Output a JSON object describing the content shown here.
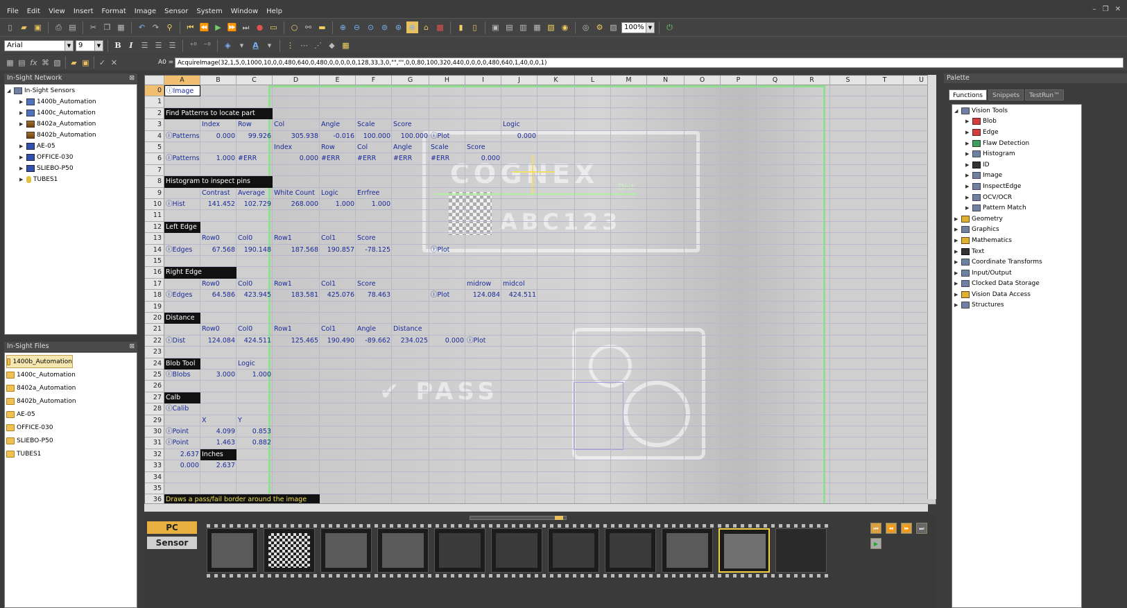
{
  "menu": [
    "File",
    "Edit",
    "View",
    "Insert",
    "Format",
    "Image",
    "Sensor",
    "System",
    "Window",
    "Help"
  ],
  "window_controls": "– ❐ ✕",
  "toolbar": {
    "zoom": "100%",
    "font_name": "Arial",
    "font_size": "9"
  },
  "formula": {
    "cell_ref": "A0 =",
    "text": "AcquireImage(32,1,5,0,1000,10,0,0,480,640,0,480,0,0,0,0,0,128,33,3,0,\"\",\"\",0,0,80,100,320,440,0,0,0,0,480,640,1,40,0,0,1)"
  },
  "network": {
    "title": "In-Sight Network",
    "root": "In-Sight Sensors",
    "items": [
      "1400b_Automation",
      "1400c_Automation",
      "8402a_Automation",
      "8402b_Automation",
      "AE-05",
      "OFFICE-030",
      "SLIEBO-P50",
      "TUBES1"
    ]
  },
  "files": {
    "title": "In-Sight Files",
    "items": [
      "1400b_Automation",
      "1400c_Automation",
      "8402a_Automation",
      "8402b_Automation",
      "AE-05",
      "OFFICE-030",
      "SLIEBO-P50",
      "TUBES1"
    ]
  },
  "sheet": {
    "columns": [
      "A",
      "B",
      "C",
      "D",
      "E",
      "F",
      "G",
      "H",
      "I",
      "J",
      "K",
      "L",
      "M",
      "N",
      "O",
      "P",
      "Q",
      "R",
      "S",
      "T",
      "U"
    ],
    "rows": [
      "0",
      "1",
      "2",
      "3",
      "4",
      "5",
      "6",
      "7",
      "8",
      "9",
      "10",
      "11",
      "12",
      "13",
      "14",
      "15",
      "16",
      "17",
      "18",
      "19",
      "20",
      "21",
      "22",
      "23",
      "24",
      "25",
      "26",
      "27",
      "28",
      "29",
      "30",
      "31",
      "32",
      "33",
      "34",
      "35",
      "36"
    ],
    "cells": [
      [
        "0",
        0,
        "ⓘImage",
        "boxed"
      ],
      [
        "2",
        0,
        "Find Patterns to locate part",
        "hdr"
      ],
      [
        "3",
        1,
        "Index",
        ""
      ],
      [
        "3",
        2,
        "Row",
        ""
      ],
      [
        "3",
        3,
        "Col",
        ""
      ],
      [
        "3",
        4,
        "Angle",
        ""
      ],
      [
        "3",
        5,
        "Scale",
        ""
      ],
      [
        "3",
        6,
        "Score",
        ""
      ],
      [
        "3",
        9,
        "Logic",
        ""
      ],
      [
        "4",
        0,
        "ⓘPatterns",
        ""
      ],
      [
        "4",
        1,
        "0.000",
        "r"
      ],
      [
        "4",
        2,
        "99.926",
        "r"
      ],
      [
        "4",
        3,
        "305.938",
        "r"
      ],
      [
        "4",
        4,
        "-0.016",
        "r"
      ],
      [
        "4",
        5,
        "100.000",
        "r"
      ],
      [
        "4",
        6,
        "100.000",
        "r"
      ],
      [
        "4",
        7,
        "ⓘPlot",
        ""
      ],
      [
        "4",
        9,
        "0.000",
        "r"
      ],
      [
        "5",
        3,
        "Index",
        ""
      ],
      [
        "5",
        4,
        "Row",
        ""
      ],
      [
        "5",
        5,
        "Col",
        ""
      ],
      [
        "5",
        6,
        "Angle",
        ""
      ],
      [
        "5",
        7,
        "Scale",
        ""
      ],
      [
        "5",
        8,
        "Score",
        ""
      ],
      [
        "6",
        0,
        "ⓘPatterns",
        ""
      ],
      [
        "6",
        1,
        "1.000",
        "r"
      ],
      [
        "6",
        2,
        "#ERR",
        ""
      ],
      [
        "6",
        3,
        "0.000",
        "r"
      ],
      [
        "6",
        4,
        "#ERR",
        ""
      ],
      [
        "6",
        5,
        "#ERR",
        ""
      ],
      [
        "6",
        6,
        "#ERR",
        ""
      ],
      [
        "6",
        7,
        "#ERR",
        ""
      ],
      [
        "6",
        8,
        "0.000",
        "r"
      ],
      [
        "8",
        0,
        "Histogram to inspect pins",
        "hdr"
      ],
      [
        "9",
        1,
        "Contrast",
        ""
      ],
      [
        "9",
        2,
        "Average",
        ""
      ],
      [
        "9",
        3,
        "White Count",
        ""
      ],
      [
        "9",
        4,
        "Logic",
        ""
      ],
      [
        "9",
        5,
        "Errfree",
        ""
      ],
      [
        "10",
        0,
        "ⓘHist",
        ""
      ],
      [
        "10",
        1,
        "141.452",
        "r"
      ],
      [
        "10",
        2,
        "102.729",
        "r"
      ],
      [
        "10",
        3,
        "268.000",
        "r"
      ],
      [
        "10",
        4,
        "1.000",
        "r"
      ],
      [
        "10",
        5,
        "1.000",
        "r"
      ],
      [
        "12",
        0,
        "Left Edge",
        "hdr"
      ],
      [
        "13",
        1,
        "Row0",
        ""
      ],
      [
        "13",
        2,
        "Col0",
        ""
      ],
      [
        "13",
        3,
        "Row1",
        ""
      ],
      [
        "13",
        4,
        "Col1",
        ""
      ],
      [
        "13",
        5,
        "Score",
        ""
      ],
      [
        "14",
        0,
        "ⓘEdges",
        ""
      ],
      [
        "14",
        1,
        "67.568",
        "r"
      ],
      [
        "14",
        2,
        "190.148",
        "r"
      ],
      [
        "14",
        3,
        "187.568",
        "r"
      ],
      [
        "14",
        4,
        "190.857",
        "r"
      ],
      [
        "14",
        5,
        "-78.125",
        "r"
      ],
      [
        "14",
        7,
        "ⓘPlot",
        ""
      ],
      [
        "16",
        0,
        "Right Edge",
        "hdr"
      ],
      [
        "17",
        1,
        "Row0",
        ""
      ],
      [
        "17",
        2,
        "Col0",
        ""
      ],
      [
        "17",
        3,
        "Row1",
        ""
      ],
      [
        "17",
        4,
        "Col1",
        ""
      ],
      [
        "17",
        5,
        "Score",
        ""
      ],
      [
        "17",
        8,
        "midrow",
        ""
      ],
      [
        "17",
        9,
        "midcol",
        ""
      ],
      [
        "18",
        0,
        "ⓘEdges",
        ""
      ],
      [
        "18",
        1,
        "64.586",
        "r"
      ],
      [
        "18",
        2,
        "423.945",
        "r"
      ],
      [
        "18",
        3,
        "183.581",
        "r"
      ],
      [
        "18",
        4,
        "425.076",
        "r"
      ],
      [
        "18",
        5,
        "78.463",
        "r"
      ],
      [
        "18",
        7,
        "ⓘPlot",
        ""
      ],
      [
        "18",
        8,
        "124.084",
        "r"
      ],
      [
        "18",
        9,
        "424.511",
        "r"
      ],
      [
        "20",
        0,
        "Distance",
        "hdr"
      ],
      [
        "21",
        1,
        "Row0",
        ""
      ],
      [
        "21",
        2,
        "Col0",
        ""
      ],
      [
        "21",
        3,
        "Row1",
        ""
      ],
      [
        "21",
        4,
        "Col1",
        ""
      ],
      [
        "21",
        5,
        "Angle",
        ""
      ],
      [
        "21",
        6,
        "Distance",
        ""
      ],
      [
        "22",
        0,
        "ⓘDist",
        ""
      ],
      [
        "22",
        1,
        "124.084",
        "r"
      ],
      [
        "22",
        2,
        "424.511",
        "r"
      ],
      [
        "22",
        3,
        "125.465",
        "r"
      ],
      [
        "22",
        4,
        "190.490",
        "r"
      ],
      [
        "22",
        5,
        "-89.662",
        "r"
      ],
      [
        "22",
        6,
        "234.025",
        "r"
      ],
      [
        "22",
        7,
        "0.000",
        "r"
      ],
      [
        "22",
        8,
        "ⓘPlot",
        ""
      ],
      [
        "24",
        0,
        "Blob Tool",
        "hdr"
      ],
      [
        "24",
        2,
        "Logic",
        ""
      ],
      [
        "25",
        0,
        "ⓘBlobs",
        ""
      ],
      [
        "25",
        1,
        "3.000",
        "r"
      ],
      [
        "25",
        2,
        "1.000",
        "r"
      ],
      [
        "27",
        0,
        "Calb",
        "hdr"
      ],
      [
        "28",
        0,
        "ⓘCalib",
        ""
      ],
      [
        "29",
        1,
        "X",
        ""
      ],
      [
        "29",
        2,
        "Y",
        ""
      ],
      [
        "30",
        0,
        "ⓘPoint",
        ""
      ],
      [
        "30",
        1,
        "4.099",
        "r"
      ],
      [
        "30",
        2,
        "0.853",
        "r"
      ],
      [
        "31",
        0,
        "ⓘPoint",
        ""
      ],
      [
        "31",
        1,
        "1.463",
        "r"
      ],
      [
        "31",
        2,
        "0.882",
        "r"
      ],
      [
        "32",
        0,
        "2.637",
        "r"
      ],
      [
        "32",
        1,
        "Inches",
        "hdr"
      ],
      [
        "33",
        0,
        "0.000",
        "r"
      ],
      [
        "33",
        1,
        "2.637",
        "r"
      ],
      [
        "36",
        0,
        "Draws a pass/fail border around the image",
        "hdry"
      ]
    ],
    "watermark": {
      "brand": "COGNEX",
      "code": "ABC123",
      "pass": "✔ PASS",
      "dist": "Dist"
    }
  },
  "filmstrip": {
    "pc_label": "PC",
    "sensor_label": "Sensor",
    "frame_count": 10,
    "active_frame": 9
  },
  "palette": {
    "title": "Palette",
    "tabs": [
      "Functions",
      "Snippets",
      "TestRun™"
    ],
    "items": [
      {
        "label": "Vision Tools",
        "level": 0,
        "icon": "vision-tools-icon",
        "open": true
      },
      {
        "label": "Blob",
        "level": 1,
        "icon": "blob-icon"
      },
      {
        "label": "Edge",
        "level": 1,
        "icon": "edge-icon"
      },
      {
        "label": "Flaw Detection",
        "level": 1,
        "icon": "flaw-detection-icon"
      },
      {
        "label": "Histogram",
        "level": 1,
        "icon": "histogram-icon"
      },
      {
        "label": "ID",
        "level": 1,
        "icon": "id-icon"
      },
      {
        "label": "Image",
        "level": 1,
        "icon": "image-icon"
      },
      {
        "label": "InspectEdge",
        "level": 1,
        "icon": "inspect-edge-icon"
      },
      {
        "label": "OCV/OCR",
        "level": 1,
        "icon": "ocv-ocr-icon"
      },
      {
        "label": "Pattern Match",
        "level": 1,
        "icon": "pattern-match-icon"
      },
      {
        "label": "Geometry",
        "level": 0,
        "icon": "geometry-icon"
      },
      {
        "label": "Graphics",
        "level": 0,
        "icon": "graphics-icon"
      },
      {
        "label": "Mathematics",
        "level": 0,
        "icon": "mathematics-icon"
      },
      {
        "label": "Text",
        "level": 0,
        "icon": "text-icon"
      },
      {
        "label": "Coordinate Transforms",
        "level": 0,
        "icon": "coordinate-transforms-icon"
      },
      {
        "label": "Input/Output",
        "level": 0,
        "icon": "input-output-icon"
      },
      {
        "label": "Clocked Data Storage",
        "level": 0,
        "icon": "clocked-data-storage-icon"
      },
      {
        "label": "Vision Data Access",
        "level": 0,
        "icon": "vision-data-access-icon"
      },
      {
        "label": "Structures",
        "level": 0,
        "icon": "structures-icon"
      }
    ]
  }
}
